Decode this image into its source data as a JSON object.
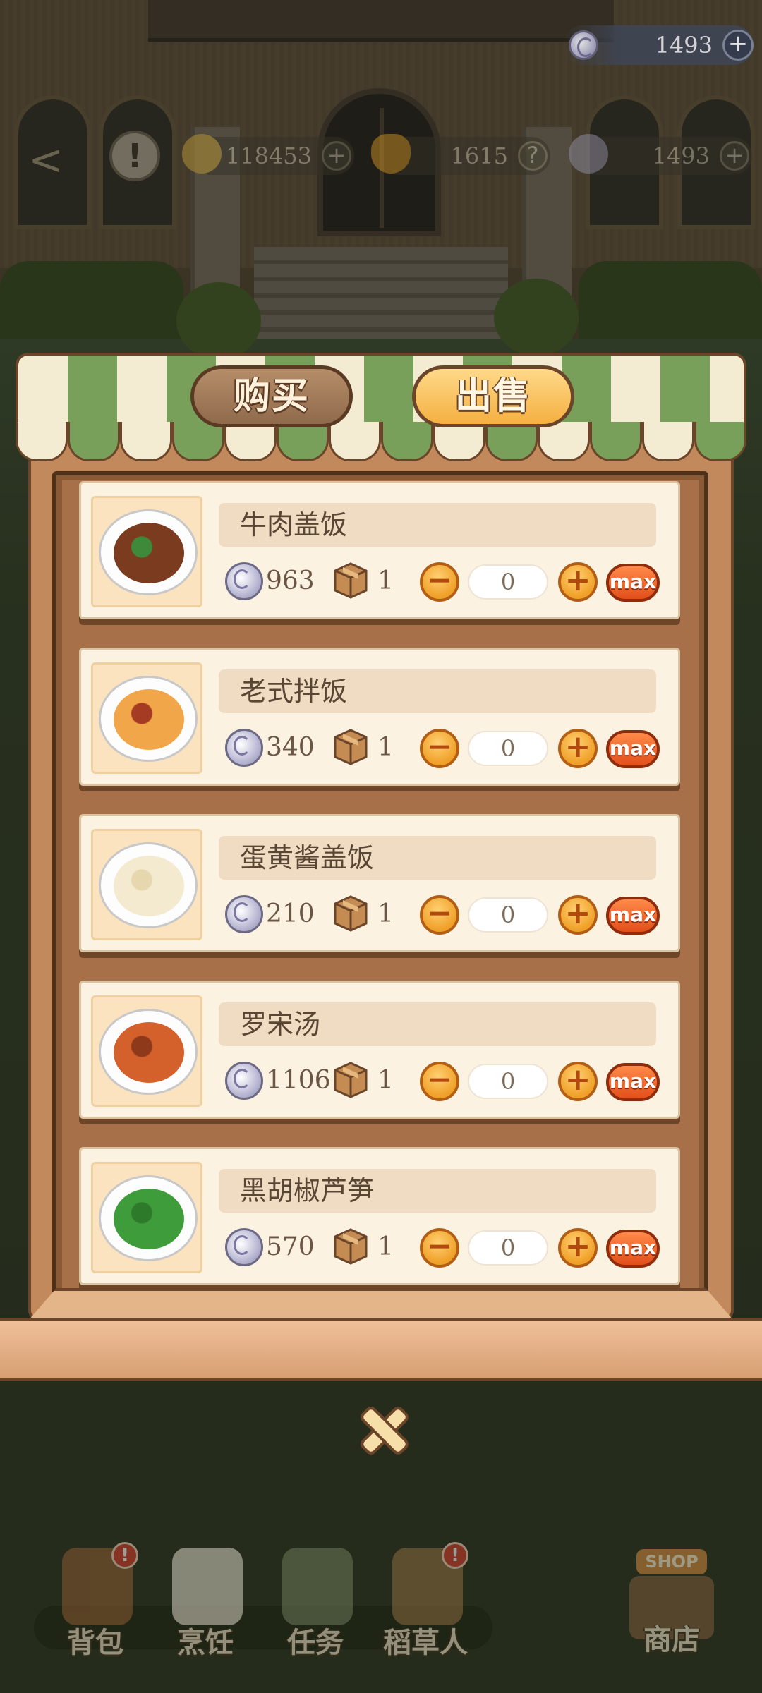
{
  "hud": {
    "currency": {
      "icon": "silver-coin-icon",
      "value": "1493",
      "plus": "+"
    },
    "background_row": {
      "gold": "118453",
      "energy": "1615",
      "silver": "1493",
      "plus": "+"
    }
  },
  "tabs": {
    "buy": "购买",
    "sell": "出售",
    "active": "sell"
  },
  "items": [
    {
      "name": "牛肉盖饭",
      "price": "963",
      "stock": "1",
      "count": "0",
      "dish_color": "#7a3b1e",
      "accent": "#3f8a3a"
    },
    {
      "name": "老式拌饭",
      "price": "340",
      "stock": "1",
      "count": "0",
      "dish_color": "#f2a64a",
      "accent": "#a53b22"
    },
    {
      "name": "蛋黄酱盖饭",
      "price": "210",
      "stock": "1",
      "count": "0",
      "dish_color": "#f4ead0",
      "accent": "#e7d7ae"
    },
    {
      "name": "罗宋汤",
      "price": "1106",
      "stock": "1",
      "count": "0",
      "dish_color": "#d4612c",
      "accent": "#8e3a1a"
    },
    {
      "name": "黑胡椒芦笋",
      "price": "570",
      "stock": "1",
      "count": "0",
      "dish_color": "#3f9c3a",
      "accent": "#2c7a2a"
    }
  ],
  "controls": {
    "minus": "−",
    "plus": "+",
    "max": "max"
  },
  "bottom_nav": [
    {
      "label": "背包",
      "badge": "!"
    },
    {
      "label": "烹饪",
      "badge": ""
    },
    {
      "label": "任务",
      "badge": ""
    },
    {
      "label": "稻草人",
      "badge": "!"
    }
  ],
  "shop": {
    "sign": "SHOP",
    "label": "商店"
  },
  "colors": {
    "panel": "#c28a5c",
    "awning_green": "#79a05a",
    "button_orange": "#f0a028",
    "max_red": "#e24f1a"
  }
}
